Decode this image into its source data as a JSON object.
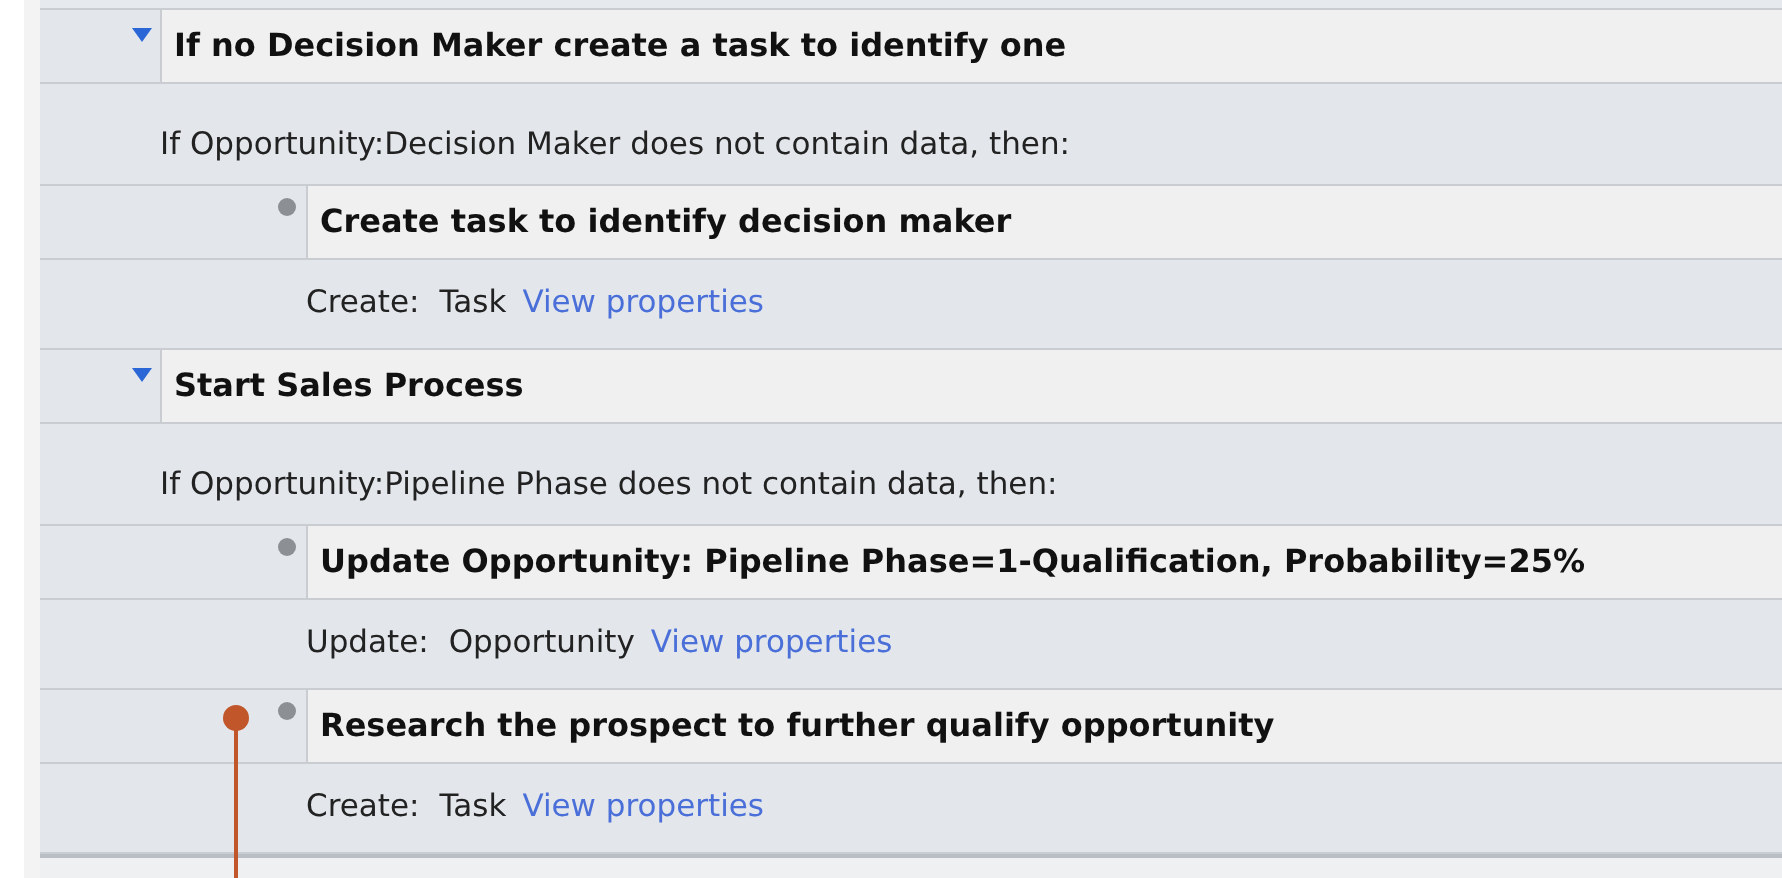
{
  "rules": [
    {
      "title": "If no Decision Maker create a task to identify one",
      "expanded": true,
      "condition": "If Opportunity:Decision Maker does not contain data, then:",
      "actions": [
        {
          "title": "Create task to identify decision maker",
          "verb": "Create:",
          "object": "Task",
          "link": "View properties"
        }
      ]
    },
    {
      "title": "Start Sales Process",
      "expanded": true,
      "condition": "If Opportunity:Pipeline Phase does not contain data, then:",
      "actions": [
        {
          "title": "Update Opportunity: Pipeline Phase=1-Qualification, Probability=25%",
          "verb": "Update:",
          "object": "Opportunity",
          "link": "View properties"
        },
        {
          "title": "Research the prospect to further qualify opportunity",
          "verb": "Create:",
          "object": "Task",
          "link": "View properties"
        }
      ]
    }
  ]
}
